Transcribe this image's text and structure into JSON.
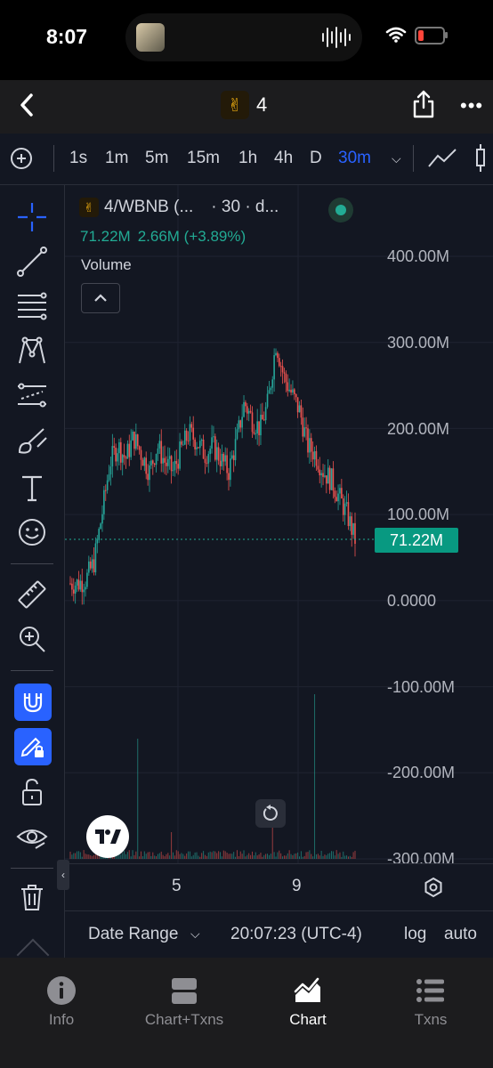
{
  "status_bar": {
    "time": "8:07"
  },
  "header": {
    "title": "4"
  },
  "intervals": {
    "items": [
      "1s",
      "1m",
      "5m",
      "15m",
      "1h",
      "4h",
      "D",
      "30m"
    ],
    "active": "30m"
  },
  "chart": {
    "legend": {
      "symbol": "4/WBNB (...",
      "interval": "· 30 · d..."
    },
    "ohlc": {
      "last": "71.22M",
      "change": "2.66M (+3.89%)"
    },
    "volume_label": "Volume",
    "current_price_tag": "71.22M",
    "y_labels": [
      "400.00M",
      "300.00M",
      "200.00M",
      "100.00M",
      "0.0000",
      "-100.00M",
      "-200.00M",
      "-300.00M"
    ],
    "x_labels": [
      "5",
      "9"
    ]
  },
  "chart_data": {
    "type": "candlestick",
    "ylim": [
      -300000000,
      400000000
    ],
    "y_tick_labels": [
      "400.00M",
      "300.00M",
      "200.00M",
      "100.00M",
      "0.0000",
      "-100.00M",
      "-200.00M",
      "-300.00M"
    ],
    "x_tick_labels": [
      "5",
      "9"
    ],
    "last_value": "71.22M",
    "change": "2.66M (+3.89%)",
    "close_path_approx": [
      20000000,
      20000000,
      25000000,
      45000000,
      100000000,
      160000000,
      180000000,
      165000000,
      190000000,
      170000000,
      150000000,
      180000000,
      160000000,
      150000000,
      175000000,
      195000000,
      185000000,
      170000000,
      180000000,
      165000000,
      150000000,
      185000000,
      230000000,
      210000000,
      200000000,
      230000000,
      300000000,
      260000000,
      240000000,
      220000000,
      180000000,
      170000000,
      150000000,
      140000000,
      120000000,
      100000000,
      71220000
    ],
    "colors": {
      "up": "#26a69a",
      "down": "#ef5350"
    }
  },
  "datebar": {
    "date_range": "Date Range",
    "clock": "20:07:23 (UTC-4)",
    "log": "log",
    "auto": "auto"
  },
  "tabs": [
    {
      "label": "Info",
      "icon": "info-icon"
    },
    {
      "label": "Chart+Txns",
      "icon": "split-view-icon"
    },
    {
      "label": "Chart",
      "icon": "chart-icon",
      "active": true
    },
    {
      "label": "Txns",
      "icon": "list-icon"
    }
  ]
}
